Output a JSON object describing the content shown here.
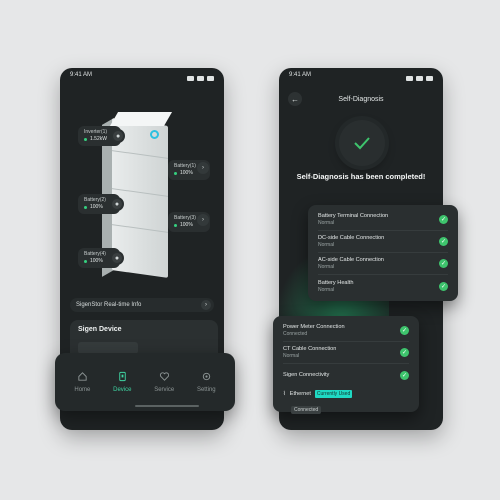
{
  "colors": {
    "accent": "#3fd6a3",
    "ok": "#3ec46d",
    "badge": "#1fd9c3",
    "panel": "#1f2324"
  },
  "left_phone": {
    "status": {
      "time": "9:41 AM"
    },
    "modules": [
      {
        "name": "Inverter(1)",
        "value": "1.52kW"
      },
      {
        "name": "Battery(1)",
        "value": "100%"
      },
      {
        "name": "Battery(2)",
        "value": "100%"
      },
      {
        "name": "Battery(3)",
        "value": "100%"
      },
      {
        "name": "Battery(4)",
        "value": "100%"
      }
    ],
    "realtime_label": "SigenStor Real-time Info",
    "card_title": "Sigen Device",
    "tabs": [
      {
        "label": "Home",
        "icon": "home-icon"
      },
      {
        "label": "Device",
        "icon": "device-icon"
      },
      {
        "label": "Service",
        "icon": "service-icon"
      },
      {
        "label": "Setting",
        "icon": "gear-icon"
      }
    ],
    "active_tab": "Device"
  },
  "right_phone": {
    "status": {
      "time": "9:41 AM"
    },
    "title": "Self-Diagnosis",
    "message": "Self-Diagnosis has been completed!",
    "checks_a": [
      {
        "name": "Battery Terminal Connection",
        "status": "Normal"
      },
      {
        "name": "DC-side Cable Connection",
        "status": "Normal"
      },
      {
        "name": "AC-side Cable Connection",
        "status": "Normal"
      },
      {
        "name": "Battery Health",
        "status": "Normal"
      }
    ],
    "checks_b": [
      {
        "name": "Power Meter Connection",
        "status": "Connected"
      },
      {
        "name": "CT Cable Connection",
        "status": "Normal"
      },
      {
        "name": "Sigen Connectivity",
        "status": ""
      }
    ],
    "ethernet": {
      "label": "Ethernet",
      "badge": "Currently Used",
      "status": "Connected"
    }
  }
}
